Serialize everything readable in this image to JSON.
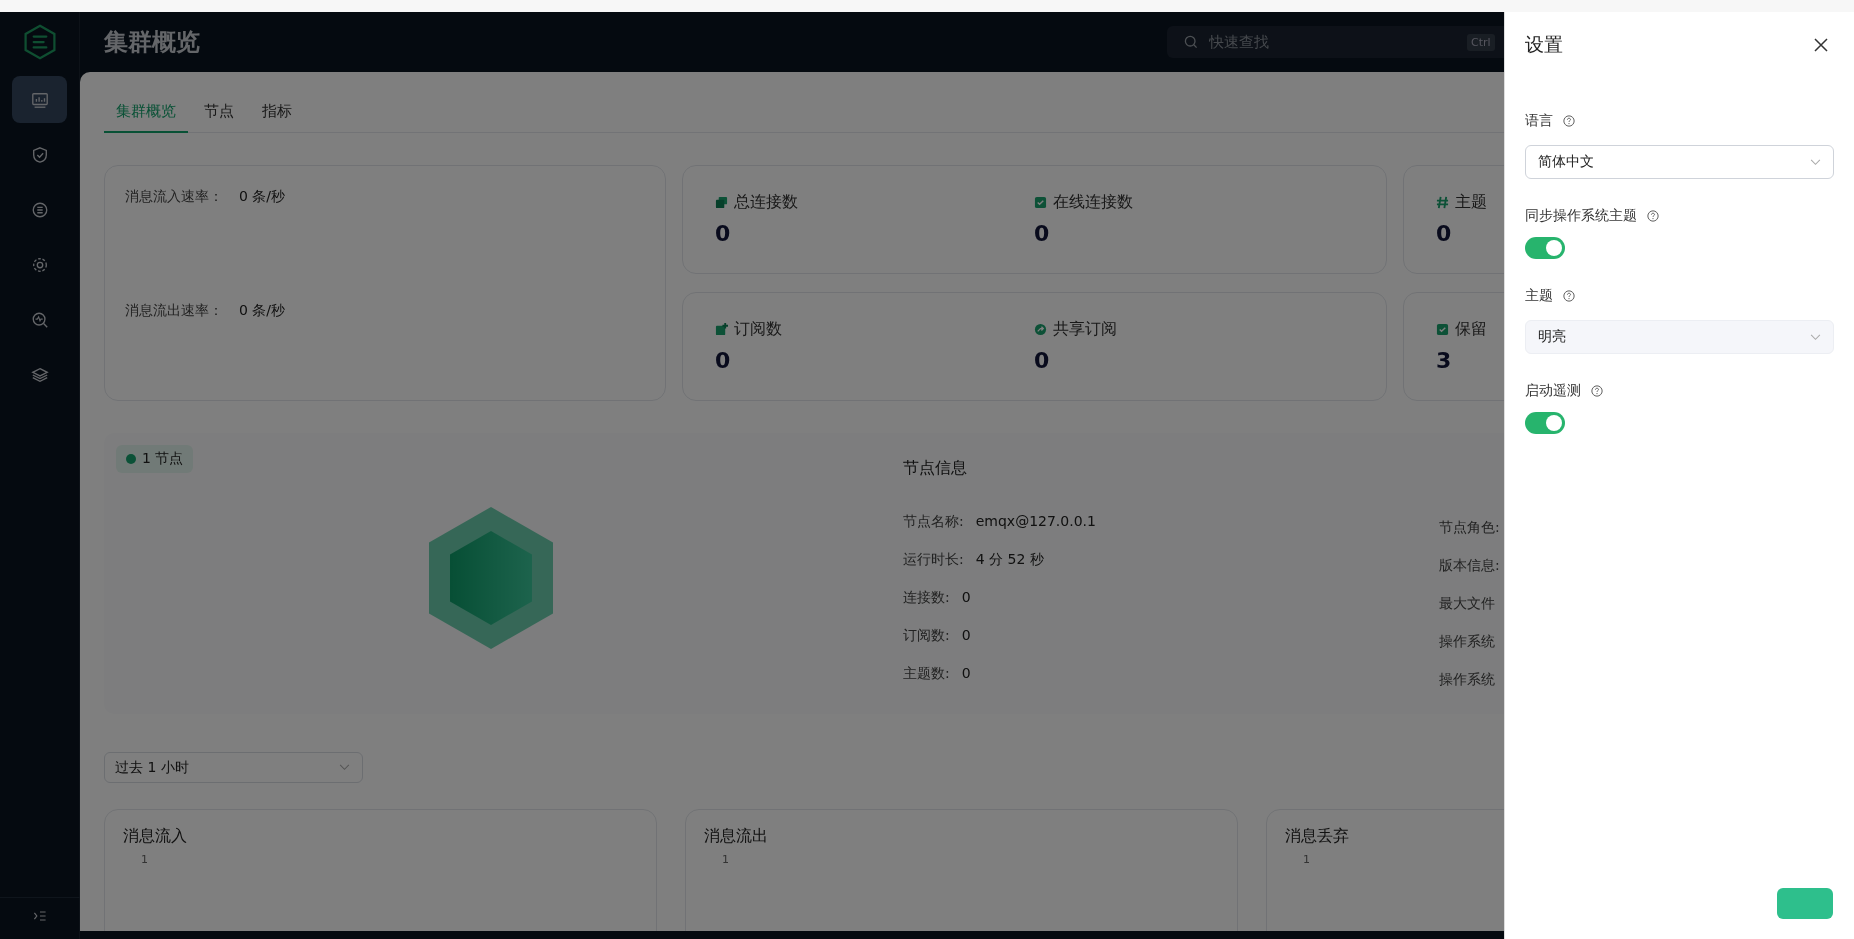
{
  "sidebar": {
    "items": [
      {
        "kind": "dashboard",
        "selected": true
      },
      {
        "kind": "shield",
        "selected": false
      },
      {
        "kind": "integration",
        "selected": false
      },
      {
        "kind": "gear",
        "selected": false
      },
      {
        "kind": "diagnose",
        "selected": false
      },
      {
        "kind": "layers",
        "selected": false
      }
    ]
  },
  "header": {
    "title": "集群概览",
    "search": {
      "placeholder": "快速查找",
      "shortcut": "Ctrl"
    }
  },
  "tabs": [
    {
      "label": "集群概览",
      "selected": true
    },
    {
      "label": "节点",
      "selected": false
    },
    {
      "label": "指标",
      "selected": false
    }
  ],
  "rates": [
    {
      "label": "消息流入速率：",
      "value": "0 条/秒"
    },
    {
      "label": "消息流出速率：",
      "value": "0 条/秒"
    }
  ],
  "stats": [
    {
      "kind": "connections",
      "label": "总连接数",
      "value": "0"
    },
    {
      "kind": "online",
      "label": "在线连接数",
      "value": "0"
    },
    {
      "kind": "topics",
      "label": "主题",
      "value": "0"
    },
    {
      "kind": "subscriptions",
      "label": "订阅数",
      "value": "0"
    },
    {
      "kind": "shared",
      "label": "共享订阅",
      "value": "0"
    },
    {
      "kind": "retained",
      "label": "保留",
      "value": "3"
    }
  ],
  "nodes": {
    "badge": "1 节点",
    "info_title": "节点信息",
    "info": [
      {
        "label": "节点名称:",
        "value": "emqx@127.0.0.1"
      },
      {
        "label": "运行时长:",
        "value": "4 分 52 秒"
      },
      {
        "label": "连接数:",
        "value": "0"
      },
      {
        "label": "订阅数:",
        "value": "0"
      },
      {
        "label": "主题数:",
        "value": "0"
      }
    ],
    "info_right": [
      "节点角色:",
      "版本信息:",
      "最大文件",
      "操作系统",
      "操作系统"
    ]
  },
  "time_range": {
    "value": "过去 1 小时"
  },
  "charts": [
    {
      "title": "消息流入",
      "axis_label": "1"
    },
    {
      "title": "消息流出",
      "axis_label": "1"
    },
    {
      "title": "消息丢弃",
      "axis_label": "1"
    }
  ],
  "settings": {
    "title": "设置",
    "fields": [
      {
        "kind": "select",
        "label": "语言",
        "value": "简体中文",
        "disabled": false
      },
      {
        "kind": "switch",
        "label": "同步操作系统主题",
        "on": true
      },
      {
        "kind": "select",
        "label": "主题",
        "value": "明亮",
        "disabled": true
      },
      {
        "kind": "switch",
        "label": "启动遥测",
        "on": true
      }
    ]
  }
}
